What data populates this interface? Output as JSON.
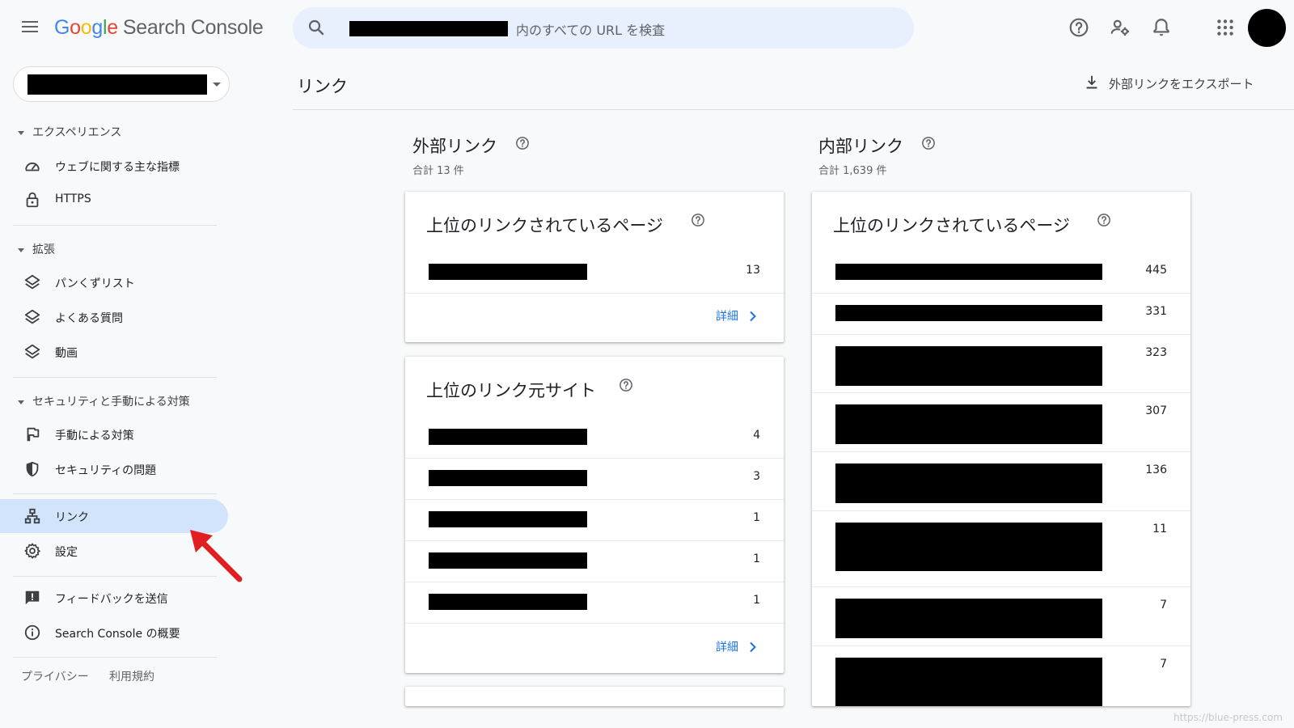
{
  "header": {
    "logo": {
      "G": "G",
      "o1": "o",
      "o2": "o",
      "g": "g",
      "l": "l",
      "e": "e",
      "product": "Search Console"
    },
    "search_placeholder": "内のすべての URL を検査",
    "icons": [
      "help-icon",
      "account-settings-icon",
      "notifications-icon",
      "apps-icon"
    ]
  },
  "sidebar": {
    "sections": {
      "experience": "エクスペリエンス",
      "enhancements": "拡張",
      "security": "セキュリティと手動による対策"
    },
    "items": {
      "core_web_vitals": "ウェブに関する主な指標",
      "https": "HTTPS",
      "breadcrumbs": "パンくずリスト",
      "faq": "よくある質問",
      "video": "動画",
      "manual_actions": "手動による対策",
      "security_issues": "セキュリティの問題",
      "links": "リンク",
      "settings": "設定",
      "feedback": "フィードバックを送信",
      "about": "Search Console の概要"
    },
    "footer": {
      "privacy": "プライバシー",
      "terms": "利用規約"
    },
    "active_item": "links"
  },
  "main": {
    "title": "リンク",
    "export_label": "外部リンクをエクスポート",
    "external": {
      "title": "外部リンク",
      "subtitle": "合計 13 件",
      "top_linked_pages": {
        "title": "上位のリンクされているページ",
        "values": [
          "13"
        ],
        "details": "詳細"
      },
      "top_linking_sites": {
        "title": "上位のリンク元サイト",
        "values": [
          "4",
          "3",
          "1",
          "1",
          "1"
        ],
        "details": "詳細"
      }
    },
    "internal": {
      "title": "内部リンク",
      "subtitle": "合計 1,639 件",
      "top_linked_pages": {
        "title": "上位のリンクされているページ",
        "values": [
          "445",
          "331",
          "323",
          "307",
          "136",
          "11",
          "7",
          "7"
        ]
      }
    }
  },
  "colors": {
    "accent": "#1a73e8",
    "active_nav": "#d2e3fc",
    "search_bg": "#e8f0fe",
    "annotation_arrow": "#e02020"
  },
  "watermark": "https://blue-press.com"
}
